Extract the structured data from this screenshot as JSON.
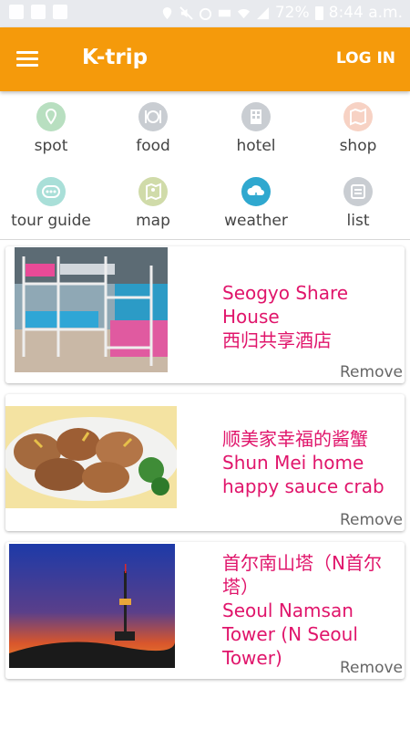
{
  "status_bar": {
    "battery": "72%",
    "time": "8:44 a.m."
  },
  "header": {
    "title": "K-trip",
    "login_label": "LOG IN"
  },
  "categories": [
    {
      "label": "spot",
      "color": "#b8dfc0"
    },
    {
      "label": "food",
      "color": "#c9cdd2"
    },
    {
      "label": "hotel",
      "color": "#c9cdd2"
    },
    {
      "label": "shop",
      "color": "#f7d2c4"
    },
    {
      "label": "tour guide",
      "color": "#a9dfd8"
    },
    {
      "label": "map",
      "color": "#d0dba9"
    },
    {
      "label": "weather",
      "color": "#2fa8cf"
    },
    {
      "label": "list",
      "color": "#c9cdd2"
    }
  ],
  "favorites": [
    {
      "title": "Seogyo Share House\n西归共享酒店",
      "remove_label": "Remove"
    },
    {
      "title": "顺美家幸福的酱蟹\nShun Mei home happy sauce crab",
      "remove_label": "Remove"
    },
    {
      "title": "首尔南山塔（N首尔塔）\nSeoul Namsan Tower (N Seoul Tower)",
      "remove_label": "Remove"
    }
  ]
}
